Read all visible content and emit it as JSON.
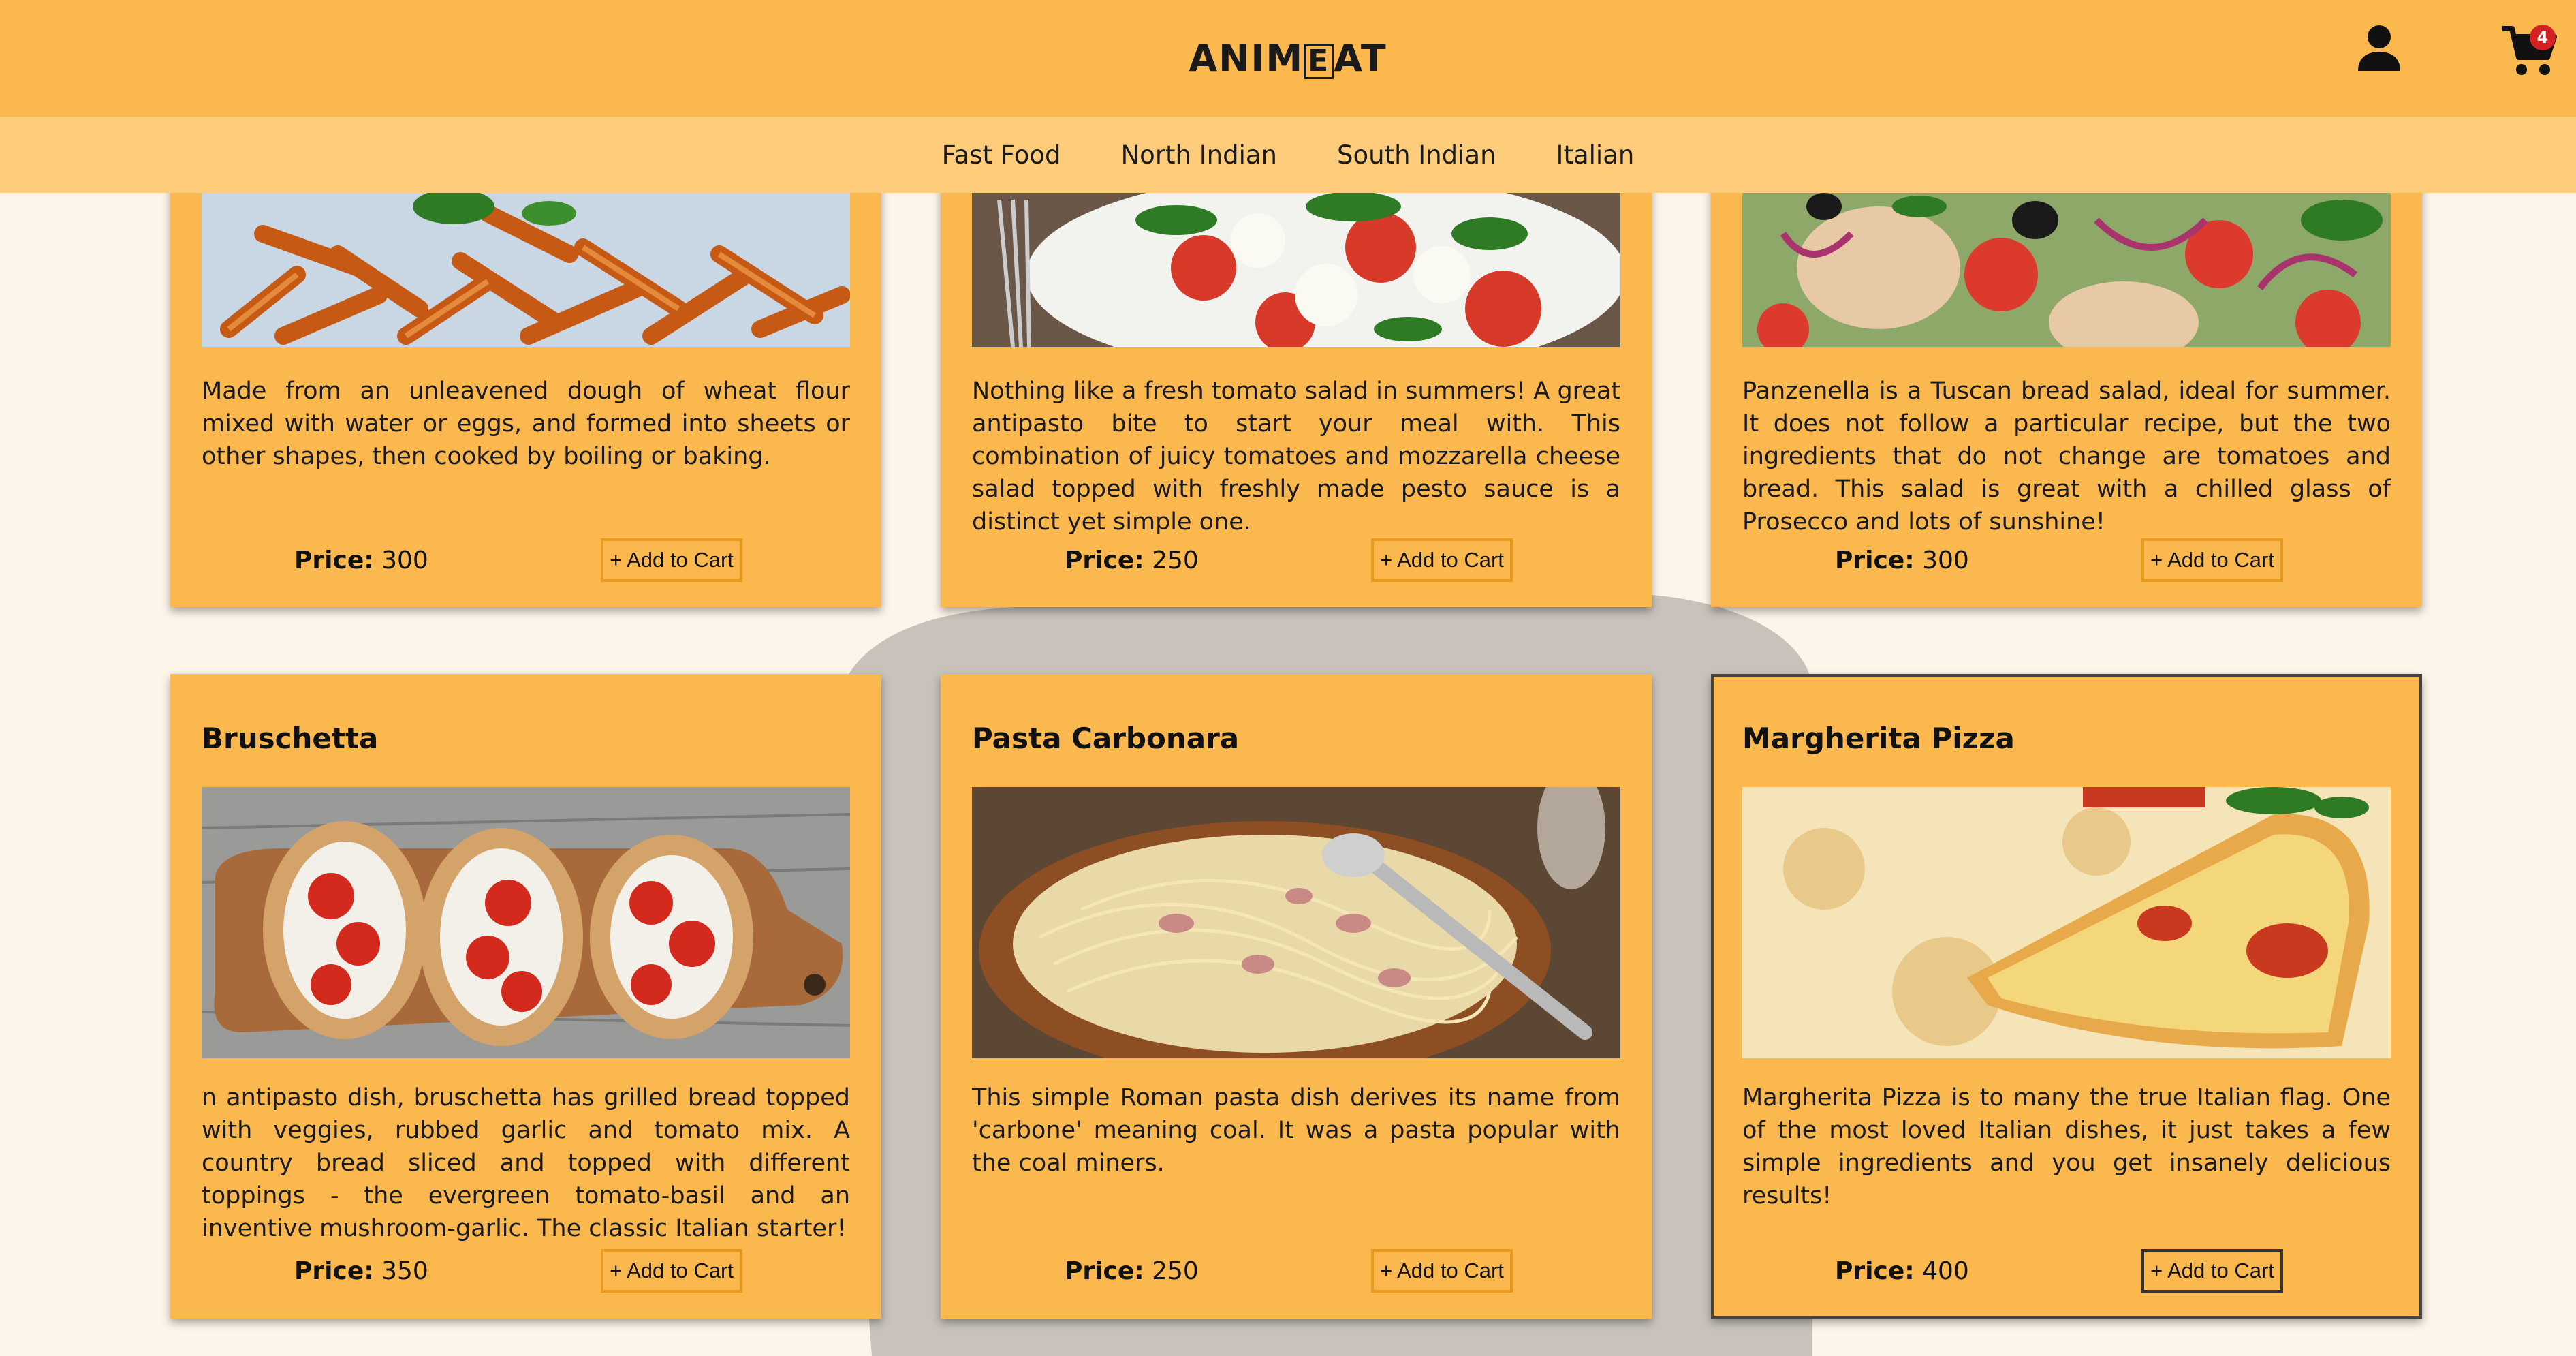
{
  "header": {
    "logo": "ANIMEAT",
    "logo_parts": [
      "ANIM",
      "E",
      "AT"
    ],
    "cart_count": "4",
    "icons": [
      "user-icon",
      "cart-icon"
    ],
    "colors": {
      "header_bg": "#fbb84f",
      "nav_bg": "#fecc7b",
      "badge": "#d32020",
      "page_bg": "#fdf5ea"
    }
  },
  "nav": {
    "categories": [
      "Fast Food",
      "North Indian",
      "South Indian",
      "Italian"
    ]
  },
  "price_label": "Price:",
  "add_label": "+ Add to Cart",
  "items": [
    {
      "name": "",
      "description": "Made from an unleavened dough of wheat flour mixed with water or eggs, and formed into sheets or other shapes, then cooked by boiling or baking.",
      "price": "300"
    },
    {
      "name": "",
      "description": "Nothing like a fresh tomato salad in summers! A great antipasto bite to start your meal with. This combination of juicy tomatoes and mozzarella cheese salad topped with freshly made pesto sauce is a distinct yet simple one.",
      "price": "250"
    },
    {
      "name": "",
      "description": "Panzenella is a Tuscan bread salad, ideal for summer. It does not follow a particular recipe, but the two ingredients that do not change are tomatoes and bread. This salad is great with a chilled glass of Prosecco and lots of sunshine!",
      "price": "300"
    },
    {
      "name": "Bruschetta",
      "description": "n antipasto dish, bruschetta has grilled bread topped with veggies, rubbed garlic and tomato mix. A country bread sliced and topped with different toppings - the evergreen tomato-basil and an inventive mushroom-garlic. The classic Italian starter!",
      "price": "350"
    },
    {
      "name": "Pasta Carbonara",
      "description": "This simple Roman pasta dish derives its name from 'carbone' meaning coal. It was a pasta popular with the coal miners.",
      "price": "250"
    },
    {
      "name": "Margherita Pizza",
      "description": "Margherita Pizza is to many the true Italian flag. One of the most loved Italian dishes, it just takes a few simple ingredients and you get insanely delicious results!",
      "price": "400"
    }
  ]
}
